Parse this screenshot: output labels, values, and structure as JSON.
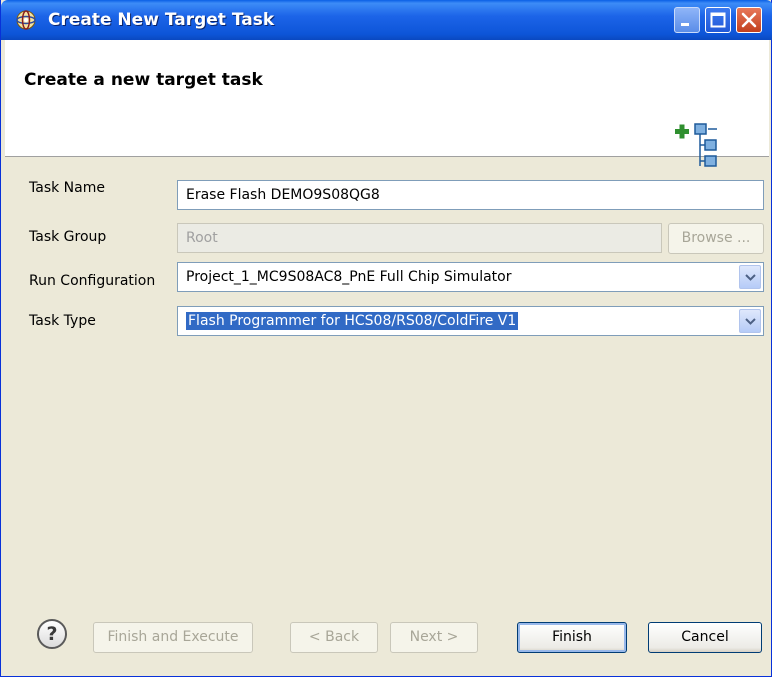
{
  "window": {
    "title": "Create New Target Task"
  },
  "banner": {
    "heading": "Create a new target task",
    "icon": "add-task-tree-icon"
  },
  "form": {
    "task_name": {
      "label": "Task Name",
      "value": "Erase Flash DEMO9S08QG8"
    },
    "task_group": {
      "label": "Task Group",
      "value": "Root",
      "browse_label": "Browse ..."
    },
    "run_configuration": {
      "label": "Run Configuration",
      "value": "Project_1_MC9S08AC8_PnE Full Chip Simulator"
    },
    "task_type": {
      "label": "Task Type",
      "value": "Flash Programmer for HCS08/RS08/ColdFire V1"
    }
  },
  "footer": {
    "help_glyph": "?",
    "finish_execute": "Finish and Execute",
    "back": "< Back",
    "next": "Next >",
    "finish": "Finish",
    "cancel": "Cancel"
  },
  "colors": {
    "title_bar": "#0a5fe5",
    "dialog_bg": "#ece9d8",
    "selection": "#316ac5"
  }
}
